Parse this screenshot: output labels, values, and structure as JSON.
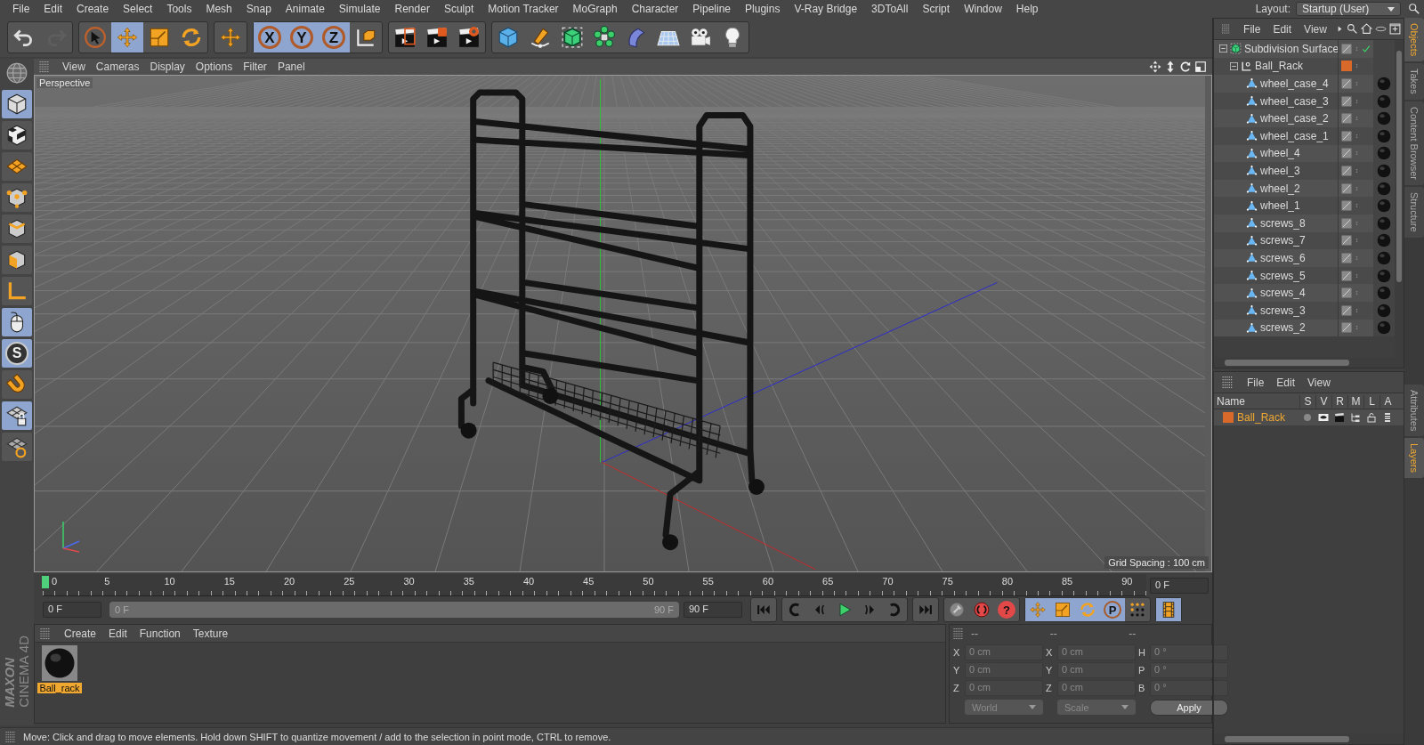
{
  "menu_bar": {
    "items": [
      "File",
      "Edit",
      "Create",
      "Select",
      "Tools",
      "Mesh",
      "Snap",
      "Animate",
      "Simulate",
      "Render",
      "Sculpt",
      "Motion Tracker",
      "MoGraph",
      "Character",
      "Pipeline",
      "Plugins",
      "V-Ray Bridge",
      "3DToAll",
      "Script",
      "Window",
      "Help"
    ],
    "layout_label": "Layout:",
    "layout_value": "Startup (User)"
  },
  "toolbar": {
    "groups": [
      [
        {
          "kind": "undo",
          "selected": false,
          "disabled": false
        },
        {
          "kind": "redo",
          "selected": false,
          "disabled": true
        }
      ],
      [
        {
          "kind": "select",
          "selected": false,
          "disabled": false
        },
        {
          "kind": "move",
          "selected": true,
          "disabled": false
        },
        {
          "kind": "scale",
          "selected": false,
          "disabled": false
        },
        {
          "kind": "rotate",
          "selected": false,
          "disabled": false
        }
      ],
      [
        {
          "kind": "transform",
          "selected": false,
          "disabled": false
        }
      ],
      [
        {
          "kind": "axis",
          "label": "X",
          "selected": true,
          "disabled": false
        },
        {
          "kind": "axis",
          "label": "Y",
          "selected": true,
          "disabled": false
        },
        {
          "kind": "axis",
          "label": "Z",
          "selected": true,
          "disabled": false
        },
        {
          "kind": "coords",
          "selected": false,
          "disabled": false
        }
      ],
      [
        {
          "kind": "render-view",
          "selected": false,
          "disabled": false
        },
        {
          "kind": "render-picture",
          "selected": false,
          "disabled": false
        },
        {
          "kind": "render-settings",
          "selected": false,
          "disabled": false
        }
      ],
      [
        {
          "kind": "cube",
          "selected": false,
          "disabled": false
        },
        {
          "kind": "pen",
          "selected": false,
          "disabled": false
        },
        {
          "kind": "subdivision",
          "selected": false,
          "disabled": false
        },
        {
          "kind": "cloner",
          "selected": false,
          "disabled": false
        },
        {
          "kind": "deformer",
          "selected": false,
          "disabled": false
        },
        {
          "kind": "floor",
          "selected": false,
          "disabled": false
        },
        {
          "kind": "camera",
          "selected": false,
          "disabled": false
        },
        {
          "kind": "light",
          "selected": false,
          "disabled": false
        }
      ]
    ]
  },
  "tool_strip": {
    "logo": [
      "MAXON",
      "CINEMA 4D"
    ],
    "buttons": [
      {
        "kind": "sphere"
      },
      {
        "kind": "model",
        "selected": true
      },
      {
        "kind": "texture",
        "selected": false
      },
      {
        "kind": "workplane",
        "selected": false
      },
      {
        "kind": "points",
        "selected": false
      },
      {
        "kind": "edges",
        "selected": false
      },
      {
        "kind": "polygons",
        "selected": false
      },
      {
        "kind": "axis-mode",
        "selected": false
      },
      {
        "kind": "tweak",
        "selected": true
      },
      {
        "kind": "snap",
        "label": "S",
        "selected": true
      },
      {
        "kind": "magnet",
        "selected": false
      },
      {
        "kind": "grid-lock",
        "selected": true
      },
      {
        "kind": "grid-sync",
        "selected": false
      }
    ]
  },
  "viewport": {
    "menu": [
      "View",
      "Cameras",
      "Display",
      "Options",
      "Filter",
      "Panel"
    ],
    "camera": "Perspective",
    "grid_spacing": "Grid Spacing : 100 cm"
  },
  "timeline": {
    "ticks": [
      "0",
      "5",
      "10",
      "15",
      "20",
      "25",
      "30",
      "35",
      "40",
      "45",
      "50",
      "55",
      "60",
      "65",
      "70",
      "75",
      "80",
      "85",
      "90"
    ],
    "playhead": {
      "level": 0
    },
    "current_frame": "0 F",
    "start": "0 F",
    "range": {
      "start": "0 F",
      "end": "90 F",
      "level": 1
    },
    "end": "90 F",
    "buttons": [
      [
        {
          "kind": "to-start"
        }
      ],
      [
        {
          "kind": "prev-key"
        },
        {
          "kind": "prev-frame"
        },
        {
          "kind": "play"
        },
        {
          "kind": "next-frame"
        },
        {
          "kind": "next-key"
        }
      ],
      [
        {
          "kind": "to-end"
        }
      ],
      [
        {
          "kind": "keyframe",
          "selected": false
        },
        {
          "kind": "record",
          "selected": false
        },
        {
          "kind": "help",
          "label": "?",
          "selected": false
        }
      ],
      [
        {
          "kind": "move",
          "selected": true
        },
        {
          "kind": "scale",
          "selected": true
        },
        {
          "kind": "rotate",
          "selected": true
        },
        {
          "kind": "param",
          "label": "P",
          "selected": true
        },
        {
          "kind": "dots",
          "selected": false
        }
      ],
      [
        {
          "kind": "film",
          "selected": true
        }
      ]
    ]
  },
  "material_manager": {
    "menu": [
      "Create",
      "Edit",
      "Function",
      "Texture"
    ],
    "materials": [
      {
        "name": "Ball_rack",
        "selected": true
      }
    ]
  },
  "coordinates": {
    "headers": [
      "--",
      "--",
      "--"
    ],
    "rows": [
      {
        "a": "X",
        "pos": "0 cm",
        "b": "X",
        "size": "0 cm",
        "c": "H",
        "rot": "0 °"
      },
      {
        "a": "Y",
        "pos": "0 cm",
        "b": "Y",
        "size": "0 cm",
        "c": "P",
        "rot": "0 °"
      },
      {
        "a": "Z",
        "pos": "0 cm",
        "b": "Z",
        "size": "0 cm",
        "c": "B",
        "rot": "0 °"
      }
    ],
    "dropdowns": [
      "World",
      "Scale"
    ],
    "apply": "Apply"
  },
  "status_bar": "Move: Click and drag to move elements. Hold down SHIFT to quantize movement / add to the selection in point mode, CTRL to remove.",
  "objects": {
    "menu": [
      "File",
      "Edit",
      "View"
    ],
    "tree": [
      {
        "name": "Subdivision Surface",
        "kind": "subdivision",
        "expanded": true,
        "enabled": true,
        "children": [
          {
            "name": "Ball_Rack",
            "kind": "null",
            "expanded": true,
            "color": "#d9692b",
            "children": [
              {
                "name": "wheel_case_4",
                "kind": "polygon",
                "material": true
              },
              {
                "name": "wheel_case_3",
                "kind": "polygon",
                "material": true
              },
              {
                "name": "wheel_case_2",
                "kind": "polygon",
                "material": true
              },
              {
                "name": "wheel_case_1",
                "kind": "polygon",
                "material": true
              },
              {
                "name": "wheel_4",
                "kind": "polygon",
                "material": true
              },
              {
                "name": "wheel_3",
                "kind": "polygon",
                "material": true
              },
              {
                "name": "wheel_2",
                "kind": "polygon",
                "material": true
              },
              {
                "name": "wheel_1",
                "kind": "polygon",
                "material": true
              },
              {
                "name": "screws_8",
                "kind": "polygon",
                "material": true
              },
              {
                "name": "screws_7",
                "kind": "polygon",
                "material": true
              },
              {
                "name": "screws_6",
                "kind": "polygon",
                "material": true
              },
              {
                "name": "screws_5",
                "kind": "polygon",
                "material": true
              },
              {
                "name": "screws_4",
                "kind": "polygon",
                "material": true
              },
              {
                "name": "screws_3",
                "kind": "polygon",
                "material": true
              },
              {
                "name": "screws_2",
                "kind": "polygon",
                "material": true
              }
            ]
          }
        ]
      }
    ]
  },
  "layers": {
    "menu": [
      "File",
      "Edit",
      "View"
    ],
    "columns": [
      "Name",
      "S",
      "V",
      "R",
      "M",
      "L",
      "A"
    ],
    "rows": [
      {
        "name": "Ball_Rack",
        "color": "#d9692b"
      }
    ]
  },
  "side_tabs": {
    "top": [
      {
        "label": "Objects",
        "selected": true
      },
      {
        "label": "Takes",
        "selected": false
      },
      {
        "label": "Content Browser",
        "selected": false
      },
      {
        "label": "Structure",
        "selected": false
      }
    ],
    "bottom": [
      {
        "label": "Attributes",
        "selected": false
      },
      {
        "label": "Layers",
        "selected": true
      }
    ]
  }
}
